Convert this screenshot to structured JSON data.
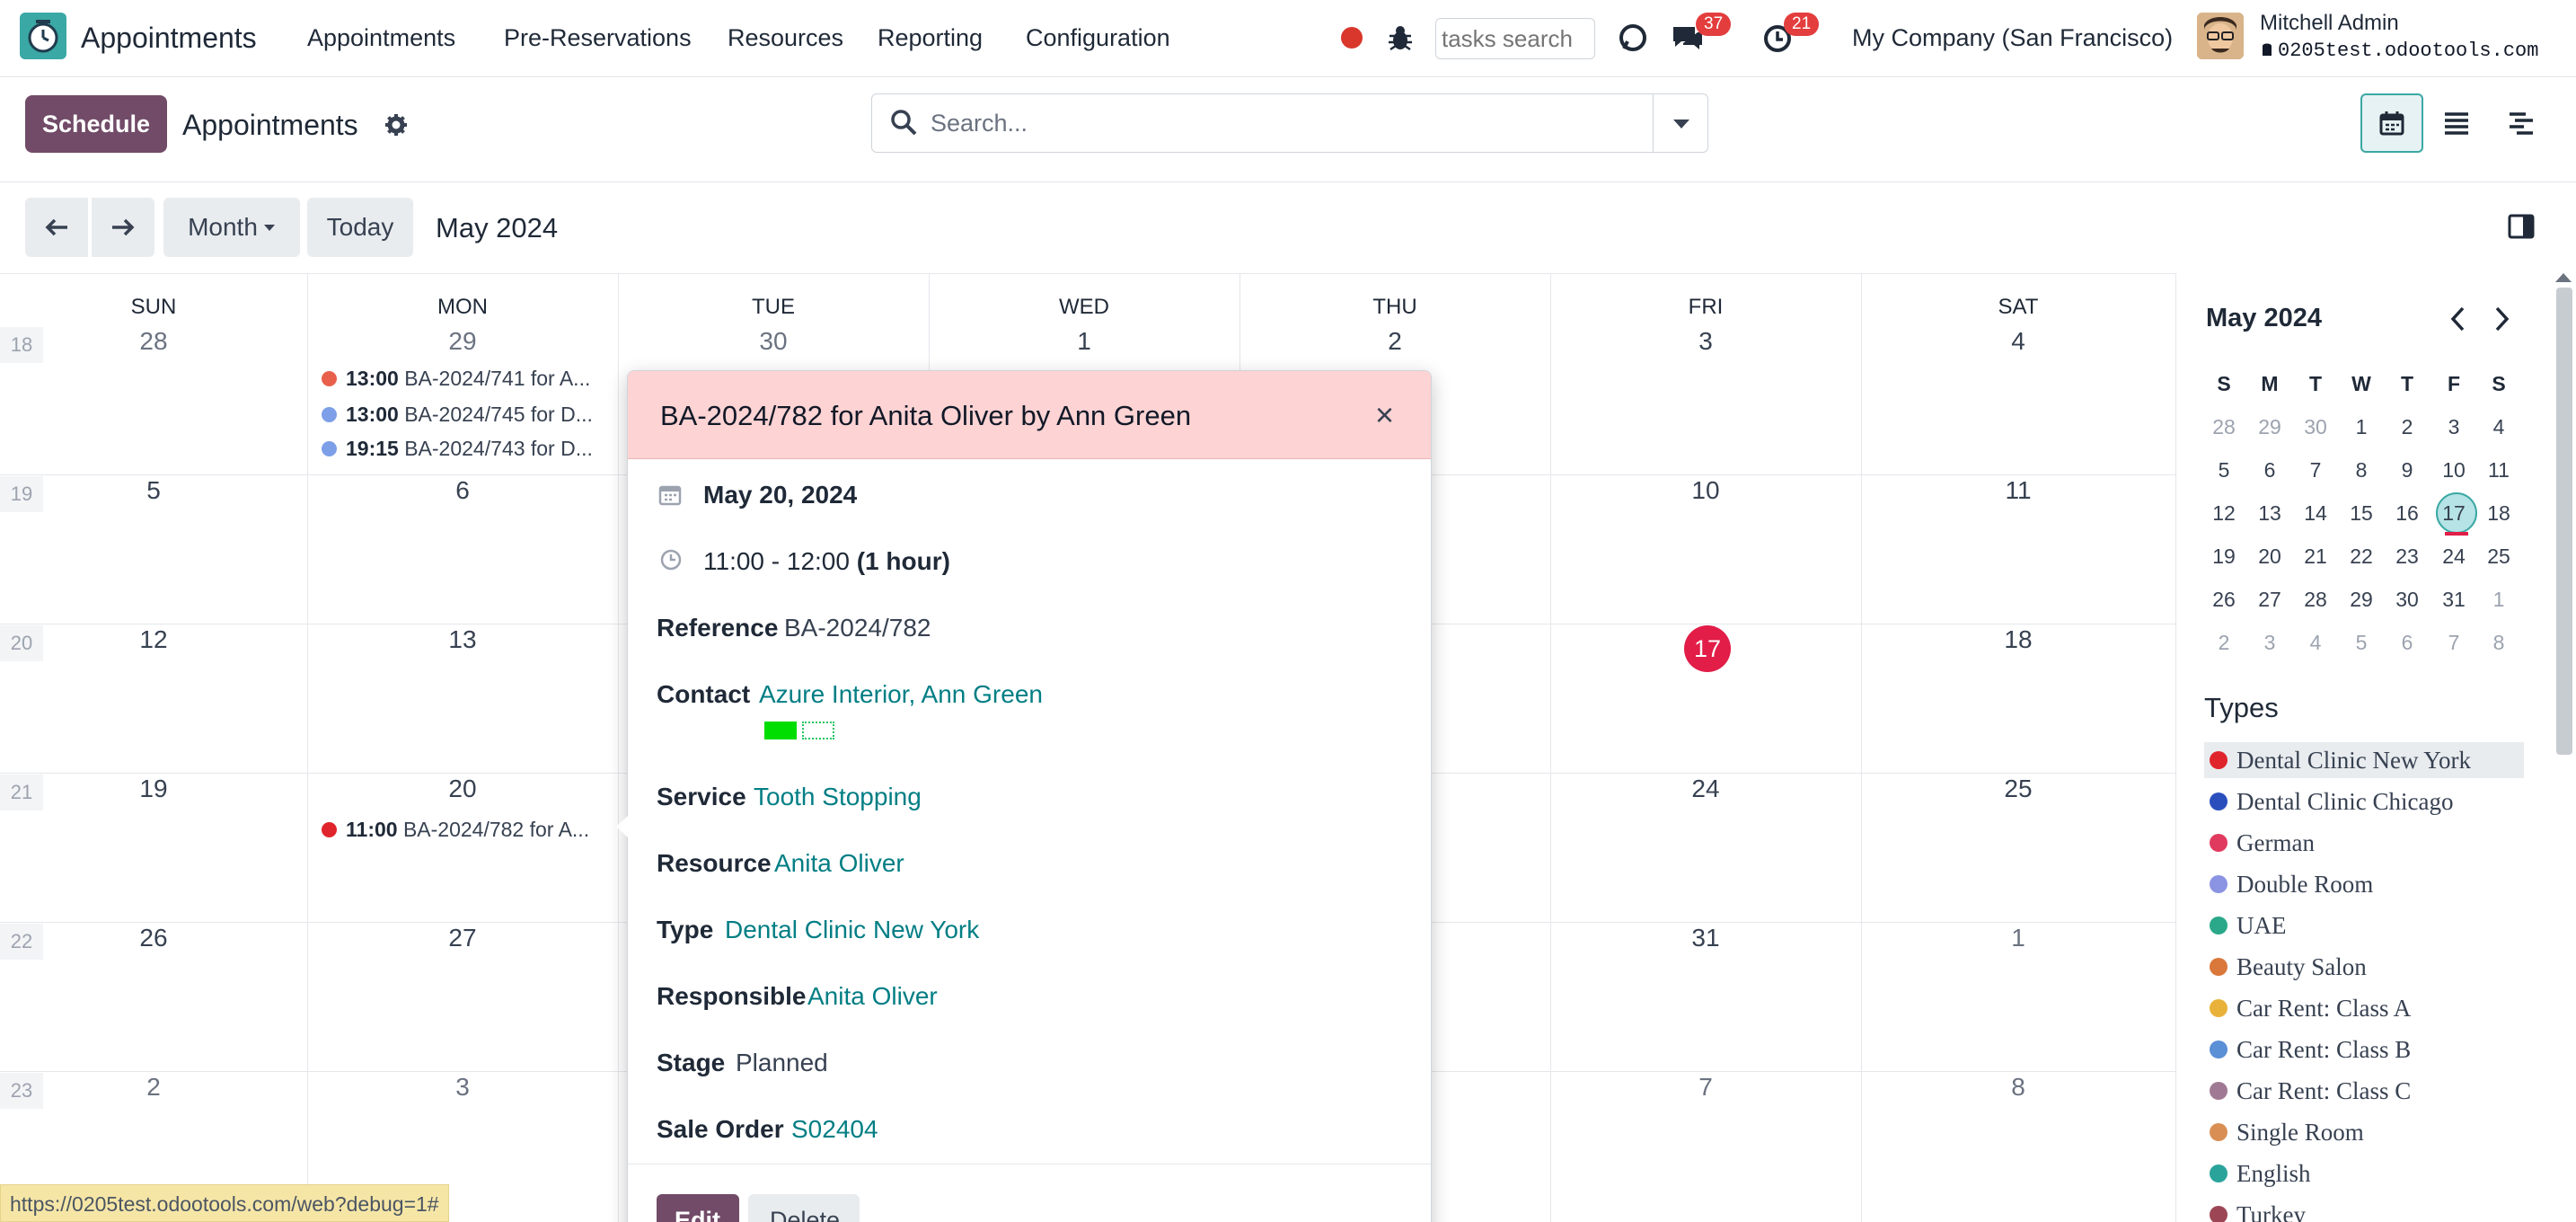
{
  "navbar": {
    "app_name": "Appointments",
    "menu": [
      "Appointments",
      "Pre-Reservations",
      "Resources",
      "Reporting",
      "Configuration"
    ],
    "tasks_placeholder": "tasks search",
    "messages_badge": "37",
    "activities_badge": "21",
    "company": "My Company (San Francisco)",
    "user_name": "Mitchell Admin",
    "db_name": "0205test.odootools.com"
  },
  "control": {
    "schedule_label": "Schedule",
    "title": "Appointments",
    "search_placeholder": "Search..."
  },
  "toolbar": {
    "scale_label": "Month",
    "today_label": "Today",
    "range_label": "May 2024"
  },
  "calendar": {
    "days_of_week": [
      "SUN",
      "MON",
      "TUE",
      "WED",
      "THU",
      "FRI",
      "SAT"
    ],
    "weeks": [
      {
        "num": "18",
        "days": [
          "28",
          "29",
          "30",
          "1",
          "2",
          "3",
          "4"
        ]
      },
      {
        "num": "19",
        "days": [
          "5",
          "6",
          "",
          "",
          "",
          "10",
          "11"
        ]
      },
      {
        "num": "20",
        "days": [
          "12",
          "13",
          "",
          "",
          "",
          "17",
          "18"
        ]
      },
      {
        "num": "21",
        "days": [
          "19",
          "20",
          "",
          "",
          "",
          "24",
          "25"
        ]
      },
      {
        "num": "22",
        "days": [
          "26",
          "27",
          "",
          "",
          "",
          "31",
          "1"
        ]
      },
      {
        "num": "23",
        "days": [
          "2",
          "3",
          "",
          "",
          "",
          "7",
          "8"
        ]
      }
    ],
    "events": [
      {
        "time": "13:00",
        "text": "BA-2024/741 for A...",
        "color": "#e8604c"
      },
      {
        "time": "13:00",
        "text": "BA-2024/745 for D...",
        "color": "#7d9fe8"
      },
      {
        "time": "19:15",
        "text": "BA-2024/743 for D...",
        "color": "#7d9fe8"
      },
      {
        "time": "11:00",
        "text": "BA-2024/782 for A...",
        "color": "#e0242c"
      }
    ],
    "today_number": "17"
  },
  "popover": {
    "title": "BA-2024/782 for Anita Oliver by Ann Green",
    "close": "×",
    "date": "May 20, 2024",
    "time": "11:00 - 12:00",
    "duration": "(1 hour)",
    "reference_label": "Reference",
    "reference": "BA-2024/782",
    "contact_label": "Contact",
    "contact": "Azure Interior, Ann Green",
    "service_label": "Service",
    "service": "Tooth Stopping",
    "resource_label": "Resource",
    "resource": "Anita Oliver",
    "type_label": "Type",
    "type": "Dental Clinic New York",
    "responsible_label": "Responsible",
    "responsible": "Anita Oliver",
    "stage_label": "Stage",
    "stage": "Planned",
    "sale_order_label": "Sale Order",
    "sale_order": "S02404",
    "edit_label": "Edit",
    "delete_label": "Delete"
  },
  "sidebar": {
    "mini_title": "May 2024",
    "mini_dow": [
      "S",
      "M",
      "T",
      "W",
      "T",
      "F",
      "S"
    ],
    "mini_weeks": [
      [
        "28",
        "29",
        "30",
        "1",
        "2",
        "3",
        "4"
      ],
      [
        "5",
        "6",
        "7",
        "8",
        "9",
        "10",
        "11"
      ],
      [
        "12",
        "13",
        "14",
        "15",
        "16",
        "17",
        "18"
      ],
      [
        "19",
        "20",
        "21",
        "22",
        "23",
        "24",
        "25"
      ],
      [
        "26",
        "27",
        "28",
        "29",
        "30",
        "31",
        "1"
      ],
      [
        "2",
        "3",
        "4",
        "5",
        "6",
        "7",
        "8"
      ]
    ],
    "types_title": "Types",
    "types": [
      {
        "name": "Dental Clinic New York",
        "color": "#e0242c"
      },
      {
        "name": "Dental Clinic Chicago",
        "color": "#2a4fbd"
      },
      {
        "name": "German",
        "color": "#e13a5f"
      },
      {
        "name": "Double Room",
        "color": "#8b93e3"
      },
      {
        "name": "UAE",
        "color": "#2aa889"
      },
      {
        "name": "Beauty Salon",
        "color": "#d9783a"
      },
      {
        "name": "Car Rent: Class A",
        "color": "#e8b23a"
      },
      {
        "name": "Car Rent: Class B",
        "color": "#5b8fd6"
      },
      {
        "name": "Car Rent: Class C",
        "color": "#a07a94"
      },
      {
        "name": "Single Room",
        "color": "#d98f54"
      },
      {
        "name": "English",
        "color": "#2aa39b"
      },
      {
        "name": "Turkey",
        "color": "#9c4655"
      }
    ]
  },
  "status_url": "https://0205test.odootools.com/web?debug=1#"
}
